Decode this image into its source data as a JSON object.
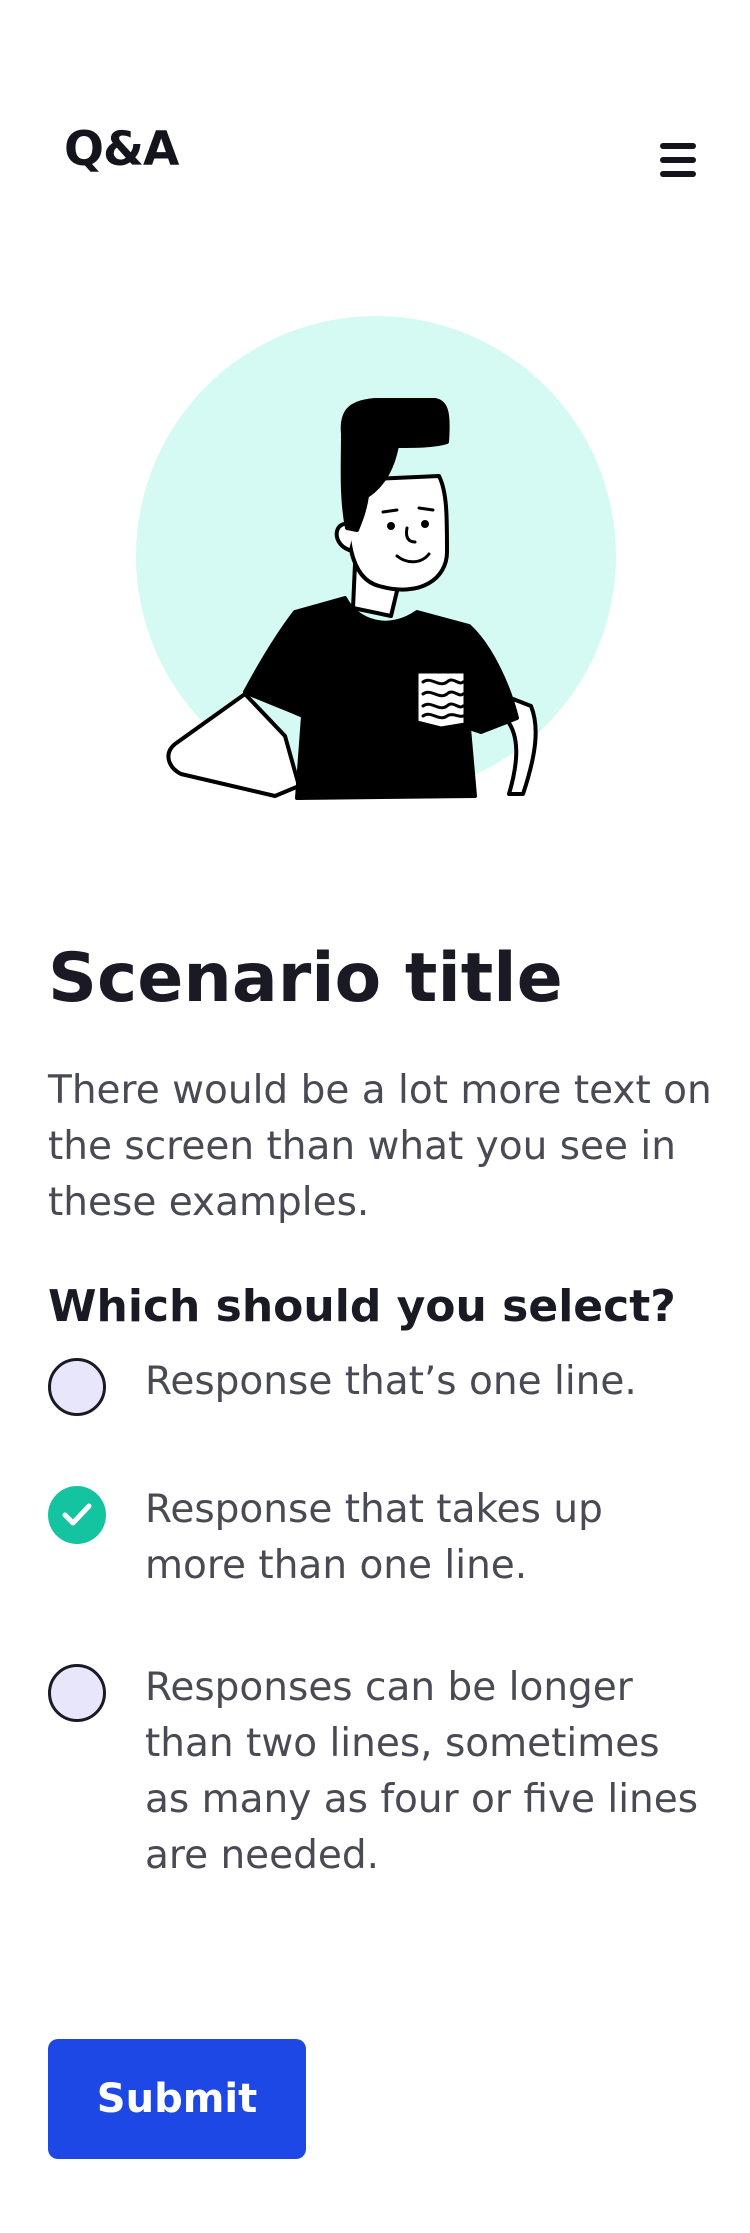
{
  "header": {
    "brand": "Q&A",
    "menu_icon": "hamburger-menu-icon"
  },
  "hero": {
    "illustration": "person-illustration",
    "bg_color": "#d4faf3"
  },
  "scenario": {
    "title": "Scenario title",
    "description": "There would be a lot more text on the screen than what you see in these examples."
  },
  "question": {
    "prompt": "Which should you select?",
    "options": [
      {
        "label": "Response that’s one line.",
        "selected": false
      },
      {
        "label": "Response that takes up more than one line.",
        "selected": true
      },
      {
        "label": "Responses can be longer than two lines, sometimes as many as four or five lines are needed.",
        "selected": false
      }
    ]
  },
  "actions": {
    "submit_label": "Submit"
  },
  "colors": {
    "accent": "#1d48e5",
    "selected": "#14c3a0",
    "radio_fill": "#e7e6fb"
  }
}
